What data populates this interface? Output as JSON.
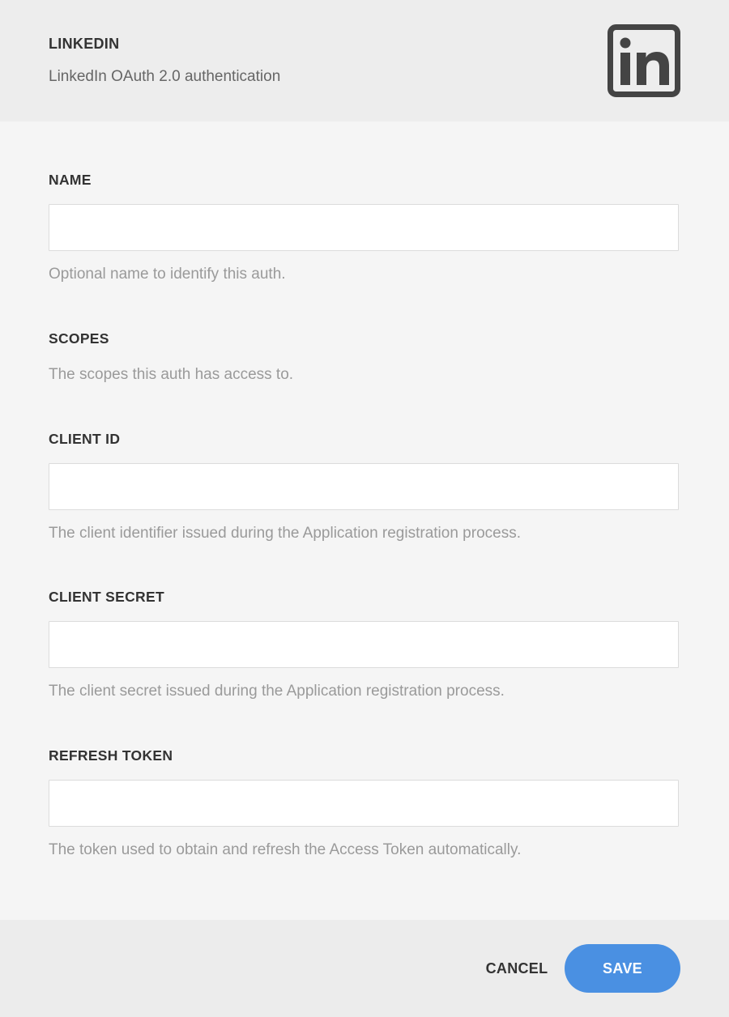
{
  "header": {
    "title": "LINKEDIN",
    "subtitle": "LinkedIn OAuth 2.0 authentication",
    "logo_icon": "linkedin-logo-icon"
  },
  "fields": {
    "name": {
      "label": "NAME",
      "value": "",
      "help": "Optional name to identify this auth."
    },
    "scopes": {
      "label": "SCOPES",
      "help": "The scopes this auth has access to."
    },
    "client_id": {
      "label": "CLIENT ID",
      "value": "",
      "help": "The client identifier issued during the Application registration process."
    },
    "client_secret": {
      "label": "CLIENT SECRET",
      "value": "",
      "help": "The client secret issued during the Application registration process."
    },
    "refresh_token": {
      "label": "REFRESH TOKEN",
      "value": "",
      "help": "The token used to obtain and refresh the Access Token automatically."
    }
  },
  "footer": {
    "cancel_label": "CANCEL",
    "save_label": "SAVE"
  },
  "colors": {
    "accent": "#4a90e2",
    "header_bg": "#ededed",
    "body_bg": "#f5f5f5",
    "text_dark": "#333333",
    "text_help": "#9a9a9a"
  }
}
